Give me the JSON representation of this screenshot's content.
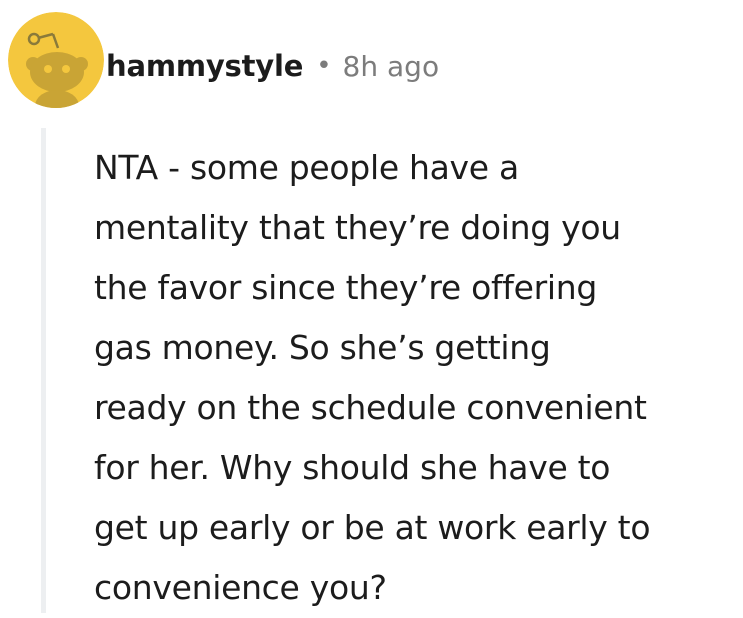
{
  "comment": {
    "avatar_icon": "snoo-avatar-icon",
    "avatar_color": "#f4c73e",
    "username": "hammystyle",
    "separator": "•",
    "timestamp": "8h ago",
    "body_lines": [
      "NTA - some people have a",
      "mentality that they’re doing you",
      "the favor since they’re offering",
      "gas money. So she’s getting",
      "ready on the schedule convenient",
      "for her. Why should she have to",
      "get up early or be at work early to",
      "convenience you?"
    ]
  }
}
